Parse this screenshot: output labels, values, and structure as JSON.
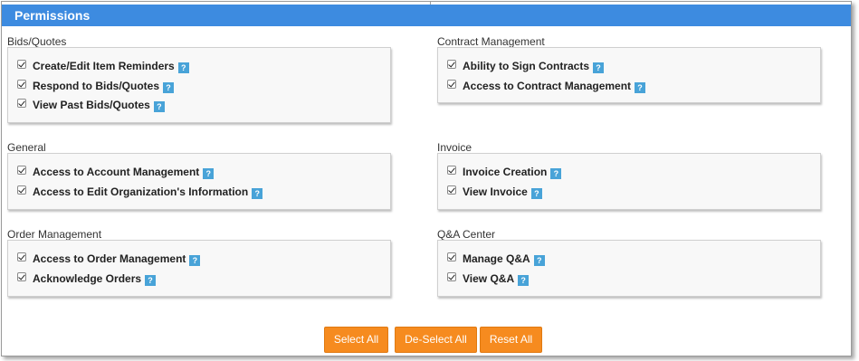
{
  "header": {
    "title": "Permissions"
  },
  "sections": [
    {
      "label": "Bids/Quotes",
      "items": [
        {
          "label": "Create/Edit Item Reminders",
          "checked": true
        },
        {
          "label": "Respond to Bids/Quotes",
          "checked": true
        },
        {
          "label": "View Past Bids/Quotes",
          "checked": true
        }
      ]
    },
    {
      "label": "Contract Management",
      "items": [
        {
          "label": "Ability to Sign Contracts",
          "checked": true
        },
        {
          "label": "Access to Contract Management",
          "checked": true
        }
      ]
    },
    {
      "label": "General",
      "items": [
        {
          "label": "Access to Account Management",
          "checked": true
        },
        {
          "label": "Access to Edit Organization's Information",
          "checked": true
        }
      ]
    },
    {
      "label": "Invoice",
      "items": [
        {
          "label": "Invoice Creation",
          "checked": true
        },
        {
          "label": "View Invoice",
          "checked": true
        }
      ]
    },
    {
      "label": "Order Management",
      "items": [
        {
          "label": "Access to Order Management",
          "checked": true
        },
        {
          "label": "Acknowledge Orders",
          "checked": true
        }
      ]
    },
    {
      "label": "Q&A Center",
      "items": [
        {
          "label": "Manage Q&A",
          "checked": true
        },
        {
          "label": "View Q&A",
          "checked": true
        }
      ]
    }
  ],
  "help_icon_glyph": "?",
  "buttons": {
    "select_all": "Select All",
    "deselect_all": "De-Select All",
    "reset_all": "Reset All"
  },
  "colors": {
    "header": "#3d8be0",
    "button": "#f68b1f",
    "help_icon": "#48a3d8"
  }
}
